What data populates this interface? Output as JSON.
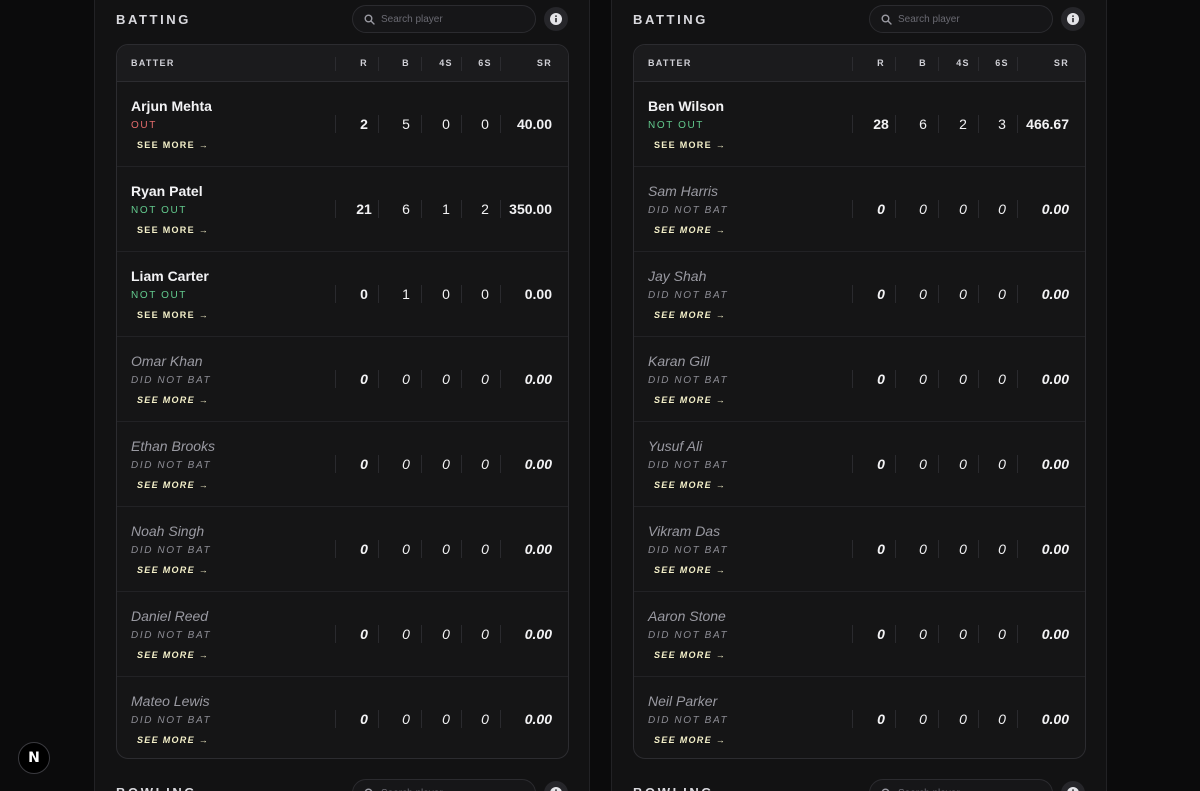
{
  "teams": [
    {
      "section_title": "BATTING",
      "search_placeholder": "Search player",
      "columns": {
        "batter": "BATTER",
        "runs": "R",
        "balls": "B",
        "fours": "4S",
        "sixes": "6S",
        "strike_rate": "SR"
      },
      "see_more_label": "SEE MORE →",
      "rows": [
        {
          "name": "Arjun Mehta",
          "status": "OUT",
          "runs": "2",
          "balls": "5",
          "fours": "0",
          "sixes": "0",
          "sr": "40.00"
        },
        {
          "name": "Ryan Patel",
          "status": "NOT OUT",
          "runs": "21",
          "balls": "6",
          "fours": "1",
          "sixes": "2",
          "sr": "350.00"
        },
        {
          "name": "Liam Carter",
          "status": "NOT OUT",
          "runs": "0",
          "balls": "1",
          "fours": "0",
          "sixes": "0",
          "sr": "0.00"
        },
        {
          "name": "Omar Khan",
          "status": "DID NOT BAT",
          "runs": "0",
          "balls": "0",
          "fours": "0",
          "sixes": "0",
          "sr": "0.00"
        },
        {
          "name": "Ethan Brooks",
          "status": "DID NOT BAT",
          "runs": "0",
          "balls": "0",
          "fours": "0",
          "sixes": "0",
          "sr": "0.00"
        },
        {
          "name": "Noah Singh",
          "status": "DID NOT BAT",
          "runs": "0",
          "balls": "0",
          "fours": "0",
          "sixes": "0",
          "sr": "0.00"
        },
        {
          "name": "Daniel Reed",
          "status": "DID NOT BAT",
          "runs": "0",
          "balls": "0",
          "fours": "0",
          "sixes": "0",
          "sr": "0.00"
        },
        {
          "name": "Mateo Lewis",
          "status": "DID NOT BAT",
          "runs": "0",
          "balls": "0",
          "fours": "0",
          "sixes": "0",
          "sr": "0.00"
        }
      ],
      "next_section_title": "BOWLING"
    },
    {
      "section_title": "BATTING",
      "search_placeholder": "Search player",
      "columns": {
        "batter": "BATTER",
        "runs": "R",
        "balls": "B",
        "fours": "4S",
        "sixes": "6S",
        "strike_rate": "SR"
      },
      "see_more_label": "SEE MORE →",
      "rows": [
        {
          "name": "Ben Wilson",
          "status": "NOT OUT",
          "runs": "28",
          "balls": "6",
          "fours": "2",
          "sixes": "3",
          "sr": "466.67"
        },
        {
          "name": "Sam Harris",
          "status": "DID NOT BAT",
          "runs": "0",
          "balls": "0",
          "fours": "0",
          "sixes": "0",
          "sr": "0.00"
        },
        {
          "name": "Jay Shah",
          "status": "DID NOT BAT",
          "runs": "0",
          "balls": "0",
          "fours": "0",
          "sixes": "0",
          "sr": "0.00"
        },
        {
          "name": "Karan Gill",
          "status": "DID NOT BAT",
          "runs": "0",
          "balls": "0",
          "fours": "0",
          "sixes": "0",
          "sr": "0.00"
        },
        {
          "name": "Yusuf Ali",
          "status": "DID NOT BAT",
          "runs": "0",
          "balls": "0",
          "fours": "0",
          "sixes": "0",
          "sr": "0.00"
        },
        {
          "name": "Vikram Das",
          "status": "DID NOT BAT",
          "runs": "0",
          "balls": "0",
          "fours": "0",
          "sixes": "0",
          "sr": "0.00"
        },
        {
          "name": "Aaron Stone",
          "status": "DID NOT BAT",
          "runs": "0",
          "balls": "0",
          "fours": "0",
          "sixes": "0",
          "sr": "0.00"
        },
        {
          "name": "Neil Parker",
          "status": "DID NOT BAT",
          "runs": "0",
          "balls": "0",
          "fours": "0",
          "sixes": "0",
          "sr": "0.00"
        }
      ],
      "next_section_title": "BOWLING"
    }
  ],
  "dev_badge": {
    "letter": "N"
  },
  "colors": {
    "not_out": "#62c98d",
    "out": "#e36b6b",
    "see_more": "#f4f0c9",
    "background": "#0b0b0c"
  }
}
